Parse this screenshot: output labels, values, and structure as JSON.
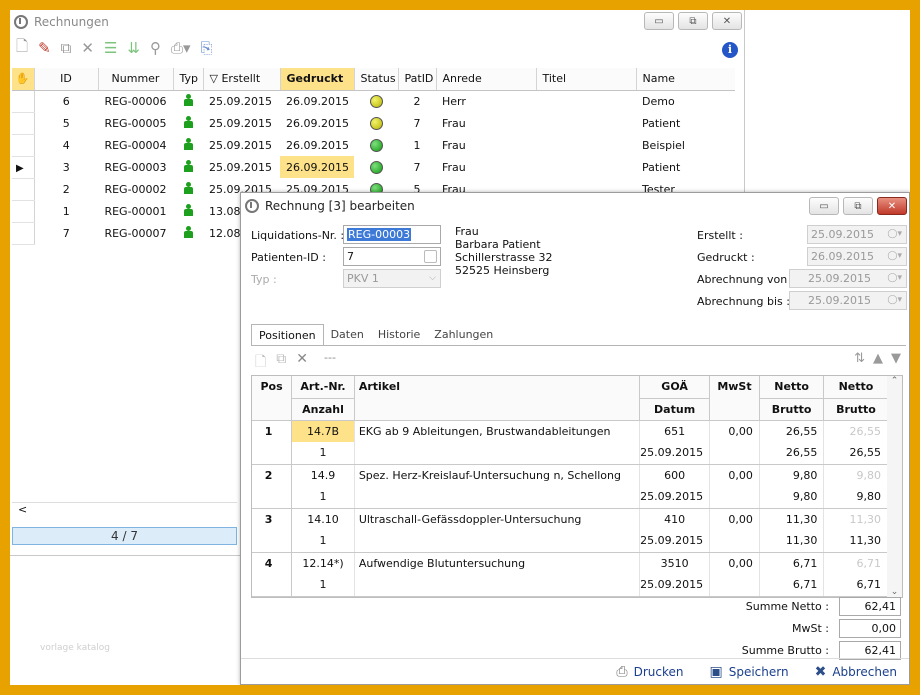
{
  "main_window": {
    "title": "Rechnungen",
    "toolbar_icons": [
      "new-icon",
      "edit-pen-icon",
      "copy-icon",
      "delete-icon",
      "list-icon",
      "refresh-list-icon",
      "search-icon",
      "print-icon",
      "export-icon",
      "info-icon"
    ],
    "columns": [
      "ID",
      "Nummer",
      "Typ",
      "Erstellt",
      "Gedruckt",
      "Status",
      "PatID",
      "Anrede",
      "Titel",
      "Name"
    ],
    "rows": [
      {
        "id": "6",
        "nummer": "REG-00006",
        "erstellt": "25.09.2015",
        "gedruckt": "26.09.2015",
        "status": "yellow",
        "patid": "2",
        "anrede": "Herr",
        "titel": "",
        "name": "Demo"
      },
      {
        "id": "5",
        "nummer": "REG-00005",
        "erstellt": "25.09.2015",
        "gedruckt": "26.09.2015",
        "status": "yellow",
        "patid": "7",
        "anrede": "Frau",
        "titel": "",
        "name": "Patient"
      },
      {
        "id": "4",
        "nummer": "REG-00004",
        "erstellt": "25.09.2015",
        "gedruckt": "26.09.2015",
        "status": "green",
        "patid": "1",
        "anrede": "Frau",
        "titel": "",
        "name": "Beispiel"
      },
      {
        "id": "3",
        "nummer": "REG-00003",
        "erstellt": "25.09.2015",
        "gedruckt": "26.09.2015",
        "status": "green",
        "patid": "7",
        "anrede": "Frau",
        "titel": "",
        "name": "Patient"
      },
      {
        "id": "2",
        "nummer": "REG-00002",
        "erstellt": "25.09.2015",
        "gedruckt": "25.09.2015",
        "status": "green",
        "patid": "5",
        "anrede": "Frau",
        "titel": "",
        "name": "Tester"
      },
      {
        "id": "1",
        "nummer": "REG-00001",
        "erstellt": "13.08",
        "gedruckt": "",
        "status": "",
        "patid": "",
        "anrede": "",
        "titel": "",
        "name": ""
      },
      {
        "id": "7",
        "nummer": "REG-00007",
        "erstellt": "12.08",
        "gedruckt": "",
        "status": "",
        "patid": "",
        "anrede": "",
        "titel": "",
        "name": ""
      }
    ],
    "scroll_left": "<",
    "pager": "4 / 7",
    "watermark": "vorlage katalog"
  },
  "dialog": {
    "title": "Rechnung [3] bearbeiten",
    "fields": {
      "liquidation_label": "Liquidations-Nr. :",
      "liquidation_value": "REG-00003",
      "patient_label": "Patienten-ID :",
      "patient_value": "7",
      "typ_label": "Typ :",
      "typ_value": "PKV 1",
      "address_line1": "Frau",
      "address_line2": "Barbara Patient",
      "address_line3": "Schillerstrasse 32",
      "address_line4": "52525 Heinsberg",
      "erstellt_label": "Erstellt :",
      "erstellt_value": "25.09.2015",
      "gedruckt_label": "Gedruckt :",
      "gedruckt_value": "26.09.2015",
      "abrechnung_von_label": "Abrechnung von :",
      "abrechnung_von_value": "25.09.2015",
      "abrechnung_bis_label": "Abrechnung bis :",
      "abrechnung_bis_value": "25.09.2015"
    },
    "tabs": [
      "Positionen",
      "Daten",
      "Historie",
      "Zahlungen"
    ],
    "toolbar_dashes": "---",
    "grid_headers": {
      "pos": "Pos",
      "art": "Art.-Nr.",
      "anzahl": "Anzahl",
      "artikel": "Artikel",
      "goa": "GOÄ",
      "datum": "Datum",
      "mwst": "MwSt",
      "netto": "Netto",
      "brutto": "Brutto",
      "netto2": "Netto",
      "brutto2": "Brutto"
    },
    "positions": [
      {
        "pos": "1",
        "art": "14.7B",
        "artikel": "EKG ab 9 Ableitungen, Brustwandableitungen",
        "goa": "651",
        "mwst": "0,00",
        "netto": "26,55",
        "netto2": "26,55",
        "anzahl": "1",
        "datum": "25.09.2015",
        "brutto": "26,55",
        "brutto2": "26,55"
      },
      {
        "pos": "2",
        "art": "14.9",
        "artikel": "Spez. Herz-Kreislauf-Untersuchung n, Schellong",
        "goa": "600",
        "mwst": "0,00",
        "netto": "9,80",
        "netto2": "9,80",
        "anzahl": "1",
        "datum": "25.09.2015",
        "brutto": "9,80",
        "brutto2": "9,80"
      },
      {
        "pos": "3",
        "art": "14.10",
        "artikel": "Ultraschall-Gefässdoppler-Untersuchung",
        "goa": "410",
        "mwst": "0,00",
        "netto": "11,30",
        "netto2": "11,30",
        "anzahl": "1",
        "datum": "25.09.2015",
        "brutto": "11,30",
        "brutto2": "11,30"
      },
      {
        "pos": "4",
        "art": "12.14*)",
        "artikel": "Aufwendige Blutuntersuchung",
        "goa": "3510",
        "mwst": "0,00",
        "netto": "6,71",
        "netto2": "6,71",
        "anzahl": "1",
        "datum": "25.09.2015",
        "brutto": "6,71",
        "brutto2": "6,71"
      }
    ],
    "summe_netto_label": "Summe Netto :",
    "summe_netto": "62,41",
    "mwst_label": "MwSt :",
    "mwst": "0,00",
    "summe_brutto_label": "Summe Brutto :",
    "summe_brutto": "62,41",
    "buttons": {
      "print": "Drucken",
      "save": "Speichern",
      "cancel": "Abbrechen"
    }
  }
}
